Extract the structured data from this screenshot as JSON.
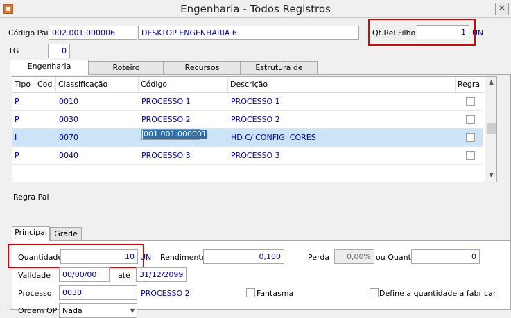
{
  "window": {
    "title": "Engenharia - Todos Registros",
    "close_glyph": "✕"
  },
  "header": {
    "codigo_pai_label": "Código Pai",
    "codigo_pai_value": "002.001.000006",
    "descricao_value": "DESKTOP ENGENHARIA 6",
    "qt_rel_filho_label": "Qt.Rel.Filho",
    "qt_rel_filho_value": "1",
    "qt_rel_filho_unit": "UN",
    "tg_label": "TG",
    "tg_value": "0"
  },
  "top_tabs": [
    "Engenharia",
    "Roteiro",
    "Recursos",
    "Estrutura de Produto"
  ],
  "grid": {
    "columns": [
      "Tipo",
      "Cod",
      "Classificação",
      "Código",
      "Descrição",
      "Regra"
    ],
    "rows": [
      {
        "tipo": "P",
        "cod": "",
        "classificacao": "0010",
        "codigo": "PROCESSO 1",
        "descricao": "PROCESSO 1",
        "regra": false,
        "selected": false
      },
      {
        "tipo": "P",
        "cod": "",
        "classificacao": "0030",
        "codigo": "PROCESSO 2",
        "descricao": "PROCESSO 2",
        "regra": false,
        "selected": false
      },
      {
        "tipo": "I",
        "cod": "",
        "classificacao": "0070",
        "codigo": "001.001.000001",
        "descricao": "HD C/ CONFIG. CORES",
        "regra": false,
        "selected": true
      },
      {
        "tipo": "P",
        "cod": "",
        "classificacao": "0040",
        "codigo": "PROCESSO 3",
        "descricao": "PROCESSO 3",
        "regra": false,
        "selected": false
      }
    ]
  },
  "regra_pai_label": "Regra Pai",
  "bottom_tabs": [
    "Principal",
    "Grade"
  ],
  "principal": {
    "quantidade_label": "Quantidade",
    "quantidade_value": "10",
    "quantidade_unit": "UN",
    "rendimento_label": "Rendimento",
    "rendimento_value": "0,100",
    "perda_label": "Perda",
    "perda_value": "0,00%",
    "ou_quant_label": "ou Quant.",
    "ou_quant_value": "0",
    "validade_label": "Validade",
    "validade_from": "00/00/00",
    "ate_label": "até",
    "validade_to": "31/12/2099",
    "processo_label": "Processo",
    "processo_code": "0030",
    "processo_name": "PROCESSO 2",
    "fantasma_label": "Fantasma",
    "define_label": "Define a quantidade a fabricar",
    "ordem_op_label": "Ordem OP",
    "ordem_op_value": "Nada"
  },
  "colors": {
    "highlight": "#e00000",
    "value_text": "#0000b0",
    "selected_row": "#cce4f7"
  }
}
